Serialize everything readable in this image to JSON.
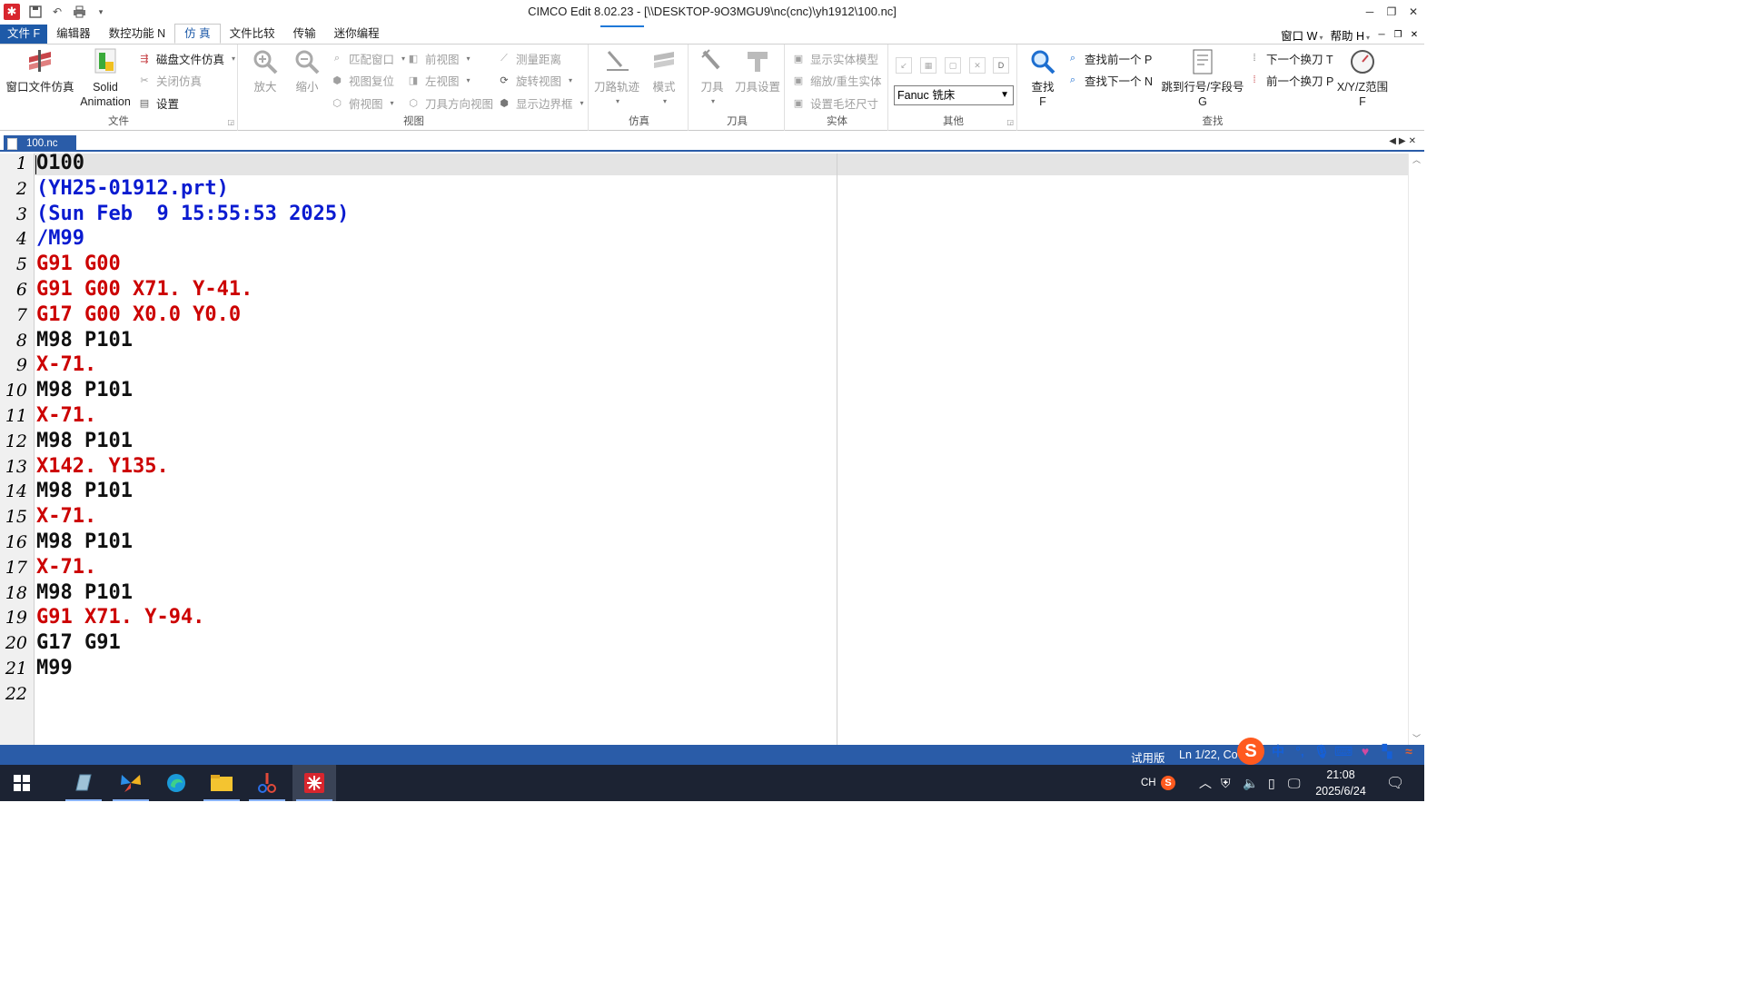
{
  "window": {
    "title": "CIMCO Edit 8.02.23 - [\\\\DESKTOP-9O3MGU9\\nc(cnc)\\yh1912\\100.nc]",
    "logo": "cimco-logo",
    "controls": [
      "minimize",
      "restore",
      "close"
    ]
  },
  "menubar": {
    "file": "文件 F",
    "tabs": [
      "编辑器",
      "数控功能 N",
      "仿 真",
      "文件比较",
      "传输",
      "迷你编程"
    ],
    "active_tab": "仿 真",
    "right": {
      "window": "窗口 W",
      "help": "帮助 H"
    }
  },
  "ribbon": {
    "file_group": {
      "label": "文件",
      "window_sim": "窗口文件仿真",
      "solid_anim_1": "Solid",
      "solid_anim_2": "Animation",
      "disk_sim": "磁盘文件仿真",
      "close_sim": "关闭仿真",
      "settings": "设置"
    },
    "view_group": {
      "label": "视图",
      "zoom_in": "放大",
      "zoom_out": "缩小",
      "fit_window": "匹配窗口",
      "view_reset": "视图复位",
      "top_view": "俯视图",
      "front_view": "前视图",
      "left_view": "左视图",
      "tool_dir_view": "刀具方向视图",
      "measure": "测量距离",
      "rotate_view": "旋转视图",
      "show_bbox": "显示边界框"
    },
    "sim_group": {
      "label": "仿真",
      "toolpath": "刀路轨迹",
      "mode": "模式"
    },
    "tool_group": {
      "label": "刀具",
      "tool": "刀具",
      "tool_settings": "刀具设置"
    },
    "solid_group": {
      "label": "实体",
      "show_solid": "显示实体模型",
      "zoom_regen": "缩放/重生实体",
      "stock_size": "设置毛坯尺寸"
    },
    "other_group": {
      "label": "其他",
      "machine_value": "Fanuc 铣床"
    },
    "find_group": {
      "label": "查找",
      "find_1": "查找",
      "find_2": "F",
      "find_prev": "查找前一个 P",
      "find_next": "查找下一个 N",
      "goto_1": "跳到行号/字段号",
      "goto_2": "G",
      "next_tool": "下一个换刀 T",
      "prev_tool": "前一个换刀 P",
      "xyz_1": "X/Y/Z范围",
      "xyz_2": "F"
    }
  },
  "document": {
    "tab_name": "100.nc",
    "lines": [
      {
        "n": "1",
        "text": "O100",
        "color": "black"
      },
      {
        "n": "2",
        "text": "(YH25-01912.prt)",
        "color": "blue"
      },
      {
        "n": "3",
        "text": "(Sun Feb  9 15:55:53 2025)",
        "color": "blue"
      },
      {
        "n": "4",
        "text": "/M99",
        "color": "blue"
      },
      {
        "n": "5",
        "text": "G91 G00",
        "color": "red"
      },
      {
        "n": "6",
        "text": "G91 G00 X71. Y-41.",
        "color": "red"
      },
      {
        "n": "7",
        "text": "G17 G00 X0.0 Y0.0",
        "color": "red"
      },
      {
        "n": "8",
        "text": "M98 P101",
        "color": "black"
      },
      {
        "n": "9",
        "text": "X-71.",
        "color": "red"
      },
      {
        "n": "10",
        "text": "M98 P101",
        "color": "black"
      },
      {
        "n": "11",
        "text": "X-71.",
        "color": "red"
      },
      {
        "n": "12",
        "text": "M98 P101",
        "color": "black"
      },
      {
        "n": "13",
        "text": "X142. Y135.",
        "color": "red"
      },
      {
        "n": "14",
        "text": "M98 P101",
        "color": "black"
      },
      {
        "n": "15",
        "text": "X-71.",
        "color": "red"
      },
      {
        "n": "16",
        "text": "M98 P101",
        "color": "black"
      },
      {
        "n": "17",
        "text": "X-71.",
        "color": "red"
      },
      {
        "n": "18",
        "text": "M98 P101",
        "color": "black"
      },
      {
        "n": "19",
        "text": "G91 X71. Y-94.",
        "color": "red"
      },
      {
        "n": "20",
        "text": "G17 G91",
        "color": "black"
      },
      {
        "n": "21",
        "text": "M99",
        "color": "black"
      },
      {
        "n": "22",
        "text": "",
        "color": "black"
      }
    ]
  },
  "statusbar": {
    "trial": "试用版",
    "position": "Ln 1/22, Co"
  },
  "ime": {
    "logo": "S",
    "lang": "中"
  },
  "taskbar": {
    "lang": "CH",
    "time": "21:08",
    "date": "2025/6/24"
  },
  "colors": {
    "accent": "#2a5ca8",
    "code_black": "#111111",
    "code_blue": "#0a1bd0",
    "code_red": "#cc0000",
    "taskbar": "#1c2333"
  }
}
